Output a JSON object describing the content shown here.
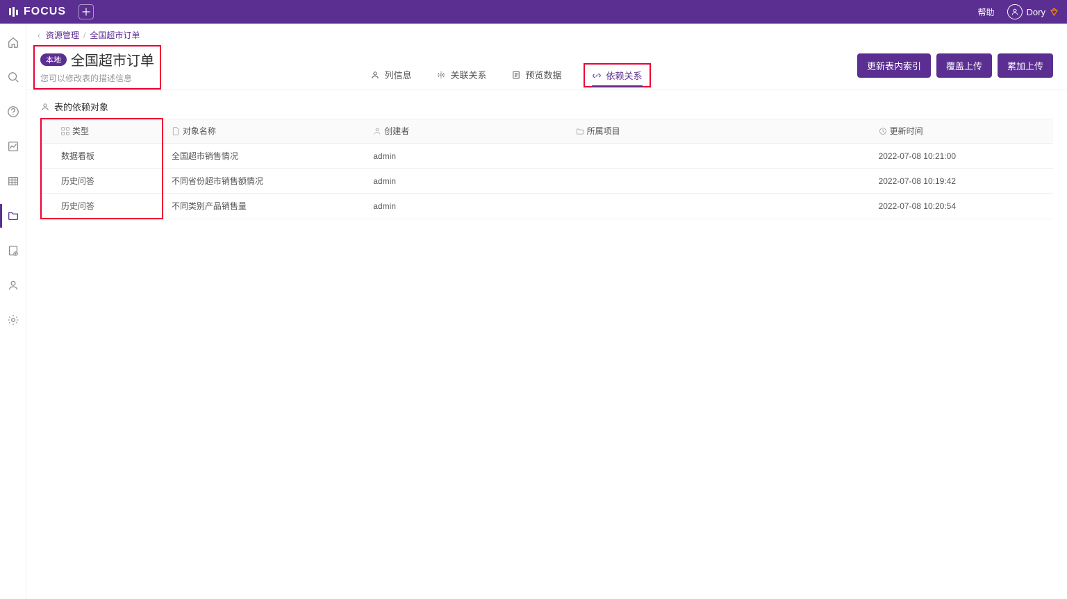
{
  "topbar": {
    "brand": "FOCUS",
    "help": "帮助",
    "user": "Dory"
  },
  "breadcrumb": {
    "root": "资源管理",
    "current": "全国超市订单"
  },
  "header": {
    "badge": "本地",
    "title": "全国超市订单",
    "description": "您可以修改表的描述信息"
  },
  "tabs": {
    "columns": "列信息",
    "relations": "关联关系",
    "preview": "预览数据",
    "dependency": "依赖关系"
  },
  "actions": {
    "refresh_index": "更新表内索引",
    "overwrite_upload": "覆盖上传",
    "append_upload": "累加上传"
  },
  "section": {
    "title": "表的依赖对象"
  },
  "table": {
    "headers": {
      "type": "类型",
      "object_name": "对象名称",
      "creator": "创建者",
      "project": "所属项目",
      "updated": "更新时间"
    },
    "rows": [
      {
        "type": "数据看板",
        "object_name": "全国超市销售情况",
        "creator": "admin",
        "project": "",
        "updated": "2022-07-08 10:21:00"
      },
      {
        "type": "历史问答",
        "object_name": "不同省份超市销售额情况",
        "creator": "admin",
        "project": "",
        "updated": "2022-07-08 10:19:42"
      },
      {
        "type": "历史问答",
        "object_name": "不同类别产品销售量",
        "creator": "admin",
        "project": "",
        "updated": "2022-07-08 10:20:54"
      }
    ]
  }
}
